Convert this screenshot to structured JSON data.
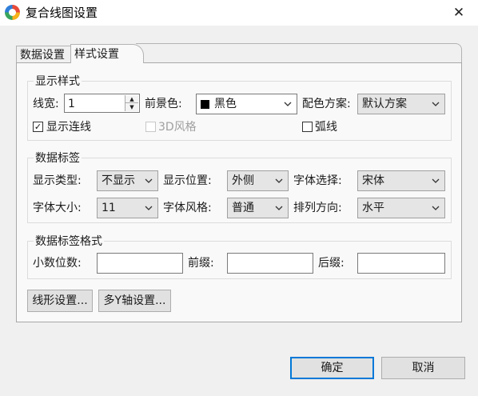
{
  "window": {
    "title": "复合线图设置",
    "close_glyph": "✕",
    "icon": "app-color-wheel-icon"
  },
  "tabs": [
    {
      "label": "数据设置",
      "active": false
    },
    {
      "label": "样式设置",
      "active": true
    }
  ],
  "display_style": {
    "title": "显示样式",
    "line_width_label": "线宽:",
    "line_width_value": "1",
    "foreground_label": "前景色:",
    "foreground_value": "黑色",
    "foreground_color": "#000000",
    "scheme_label": "配色方案:",
    "scheme_value": "默认方案",
    "show_lines_label": "显示连线",
    "show_lines_checked": true,
    "style3d_label": "3D风格",
    "style3d_checked": false,
    "arc_label": "弧线",
    "arc_checked": false
  },
  "data_label": {
    "title": "数据标签",
    "display_type_label": "显示类型:",
    "display_type_value": "不显示",
    "position_label": "显示位置:",
    "position_value": "外侧",
    "font_label": "字体选择:",
    "font_value": "宋体",
    "font_size_label": "字体大小:",
    "font_size_value": "11",
    "font_style_label": "字体风格:",
    "font_style_value": "普通",
    "direction_label": "排列方向:",
    "direction_value": "水平"
  },
  "data_label_format": {
    "title": "数据标签格式",
    "decimals_label": "小数位数:",
    "decimals_value": "",
    "prefix_label": "前缀:",
    "prefix_value": "",
    "suffix_label": "后缀:",
    "suffix_value": ""
  },
  "buttons": {
    "line_settings": "线形设置...",
    "multi_y_axis": "多Y轴设置...",
    "ok": "确定",
    "cancel": "取消"
  },
  "check_glyph": "✓",
  "colors": {
    "accent": "#0078d7",
    "window_bg": "#f0f0f0",
    "panel_bg": "#f9f9f9"
  }
}
